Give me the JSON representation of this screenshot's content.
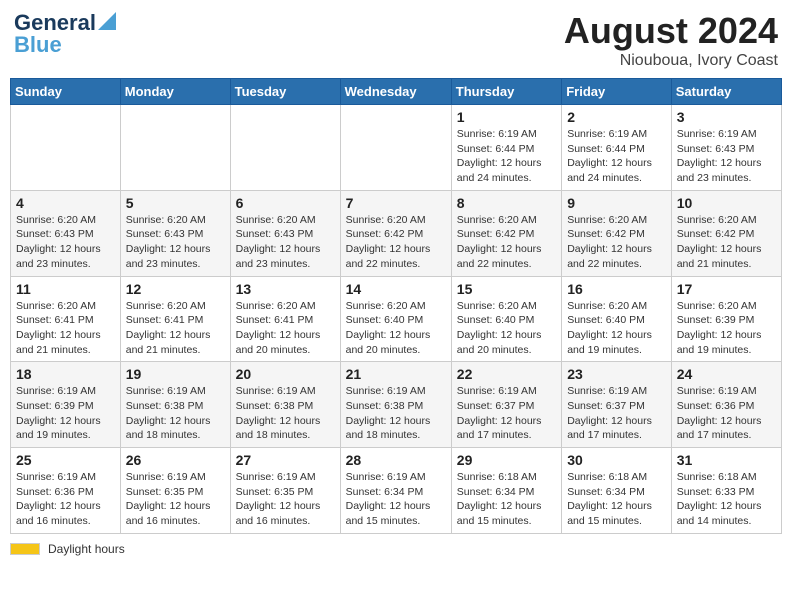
{
  "title": "August 2024",
  "subtitle": "Niouboua, Ivory Coast",
  "logo": {
    "line1": "General",
    "line2": "Blue"
  },
  "days_of_week": [
    "Sunday",
    "Monday",
    "Tuesday",
    "Wednesday",
    "Thursday",
    "Friday",
    "Saturday"
  ],
  "footer_label": "Daylight hours",
  "weeks": [
    {
      "days": [
        {
          "num": "",
          "info": ""
        },
        {
          "num": "",
          "info": ""
        },
        {
          "num": "",
          "info": ""
        },
        {
          "num": "",
          "info": ""
        },
        {
          "num": "1",
          "info": "Sunrise: 6:19 AM\nSunset: 6:44 PM\nDaylight: 12 hours\nand 24 minutes."
        },
        {
          "num": "2",
          "info": "Sunrise: 6:19 AM\nSunset: 6:44 PM\nDaylight: 12 hours\nand 24 minutes."
        },
        {
          "num": "3",
          "info": "Sunrise: 6:19 AM\nSunset: 6:43 PM\nDaylight: 12 hours\nand 23 minutes."
        }
      ]
    },
    {
      "days": [
        {
          "num": "4",
          "info": "Sunrise: 6:20 AM\nSunset: 6:43 PM\nDaylight: 12 hours\nand 23 minutes."
        },
        {
          "num": "5",
          "info": "Sunrise: 6:20 AM\nSunset: 6:43 PM\nDaylight: 12 hours\nand 23 minutes."
        },
        {
          "num": "6",
          "info": "Sunrise: 6:20 AM\nSunset: 6:43 PM\nDaylight: 12 hours\nand 23 minutes."
        },
        {
          "num": "7",
          "info": "Sunrise: 6:20 AM\nSunset: 6:42 PM\nDaylight: 12 hours\nand 22 minutes."
        },
        {
          "num": "8",
          "info": "Sunrise: 6:20 AM\nSunset: 6:42 PM\nDaylight: 12 hours\nand 22 minutes."
        },
        {
          "num": "9",
          "info": "Sunrise: 6:20 AM\nSunset: 6:42 PM\nDaylight: 12 hours\nand 22 minutes."
        },
        {
          "num": "10",
          "info": "Sunrise: 6:20 AM\nSunset: 6:42 PM\nDaylight: 12 hours\nand 21 minutes."
        }
      ]
    },
    {
      "days": [
        {
          "num": "11",
          "info": "Sunrise: 6:20 AM\nSunset: 6:41 PM\nDaylight: 12 hours\nand 21 minutes."
        },
        {
          "num": "12",
          "info": "Sunrise: 6:20 AM\nSunset: 6:41 PM\nDaylight: 12 hours\nand 21 minutes."
        },
        {
          "num": "13",
          "info": "Sunrise: 6:20 AM\nSunset: 6:41 PM\nDaylight: 12 hours\nand 20 minutes."
        },
        {
          "num": "14",
          "info": "Sunrise: 6:20 AM\nSunset: 6:40 PM\nDaylight: 12 hours\nand 20 minutes."
        },
        {
          "num": "15",
          "info": "Sunrise: 6:20 AM\nSunset: 6:40 PM\nDaylight: 12 hours\nand 20 minutes."
        },
        {
          "num": "16",
          "info": "Sunrise: 6:20 AM\nSunset: 6:40 PM\nDaylight: 12 hours\nand 19 minutes."
        },
        {
          "num": "17",
          "info": "Sunrise: 6:20 AM\nSunset: 6:39 PM\nDaylight: 12 hours\nand 19 minutes."
        }
      ]
    },
    {
      "days": [
        {
          "num": "18",
          "info": "Sunrise: 6:19 AM\nSunset: 6:39 PM\nDaylight: 12 hours\nand 19 minutes."
        },
        {
          "num": "19",
          "info": "Sunrise: 6:19 AM\nSunset: 6:38 PM\nDaylight: 12 hours\nand 18 minutes."
        },
        {
          "num": "20",
          "info": "Sunrise: 6:19 AM\nSunset: 6:38 PM\nDaylight: 12 hours\nand 18 minutes."
        },
        {
          "num": "21",
          "info": "Sunrise: 6:19 AM\nSunset: 6:38 PM\nDaylight: 12 hours\nand 18 minutes."
        },
        {
          "num": "22",
          "info": "Sunrise: 6:19 AM\nSunset: 6:37 PM\nDaylight: 12 hours\nand 17 minutes."
        },
        {
          "num": "23",
          "info": "Sunrise: 6:19 AM\nSunset: 6:37 PM\nDaylight: 12 hours\nand 17 minutes."
        },
        {
          "num": "24",
          "info": "Sunrise: 6:19 AM\nSunset: 6:36 PM\nDaylight: 12 hours\nand 17 minutes."
        }
      ]
    },
    {
      "days": [
        {
          "num": "25",
          "info": "Sunrise: 6:19 AM\nSunset: 6:36 PM\nDaylight: 12 hours\nand 16 minutes."
        },
        {
          "num": "26",
          "info": "Sunrise: 6:19 AM\nSunset: 6:35 PM\nDaylight: 12 hours\nand 16 minutes."
        },
        {
          "num": "27",
          "info": "Sunrise: 6:19 AM\nSunset: 6:35 PM\nDaylight: 12 hours\nand 16 minutes."
        },
        {
          "num": "28",
          "info": "Sunrise: 6:19 AM\nSunset: 6:34 PM\nDaylight: 12 hours\nand 15 minutes."
        },
        {
          "num": "29",
          "info": "Sunrise: 6:18 AM\nSunset: 6:34 PM\nDaylight: 12 hours\nand 15 minutes."
        },
        {
          "num": "30",
          "info": "Sunrise: 6:18 AM\nSunset: 6:34 PM\nDaylight: 12 hours\nand 15 minutes."
        },
        {
          "num": "31",
          "info": "Sunrise: 6:18 AM\nSunset: 6:33 PM\nDaylight: 12 hours\nand 14 minutes."
        }
      ]
    }
  ]
}
